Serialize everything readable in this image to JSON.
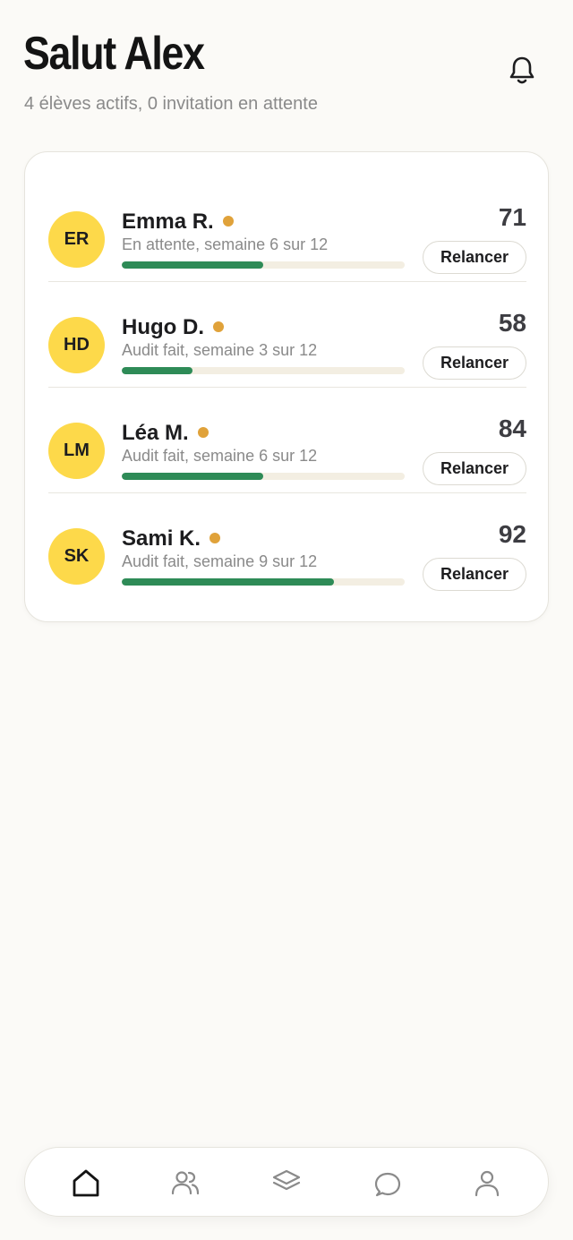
{
  "header": {
    "title": "Salut Alex",
    "subtitle": "4 élèves actifs, 0 invitation en attente",
    "notification_icon": "bell-icon"
  },
  "students": [
    {
      "initials": "ER",
      "name": "Emma R.",
      "status": "En attente, semaine 6 sur 12",
      "progress": 0.5,
      "score": "71",
      "action": "Relancer"
    },
    {
      "initials": "HD",
      "name": "Hugo D.",
      "status": "Audit fait, semaine 3 sur 12",
      "progress": 0.25,
      "score": "58",
      "action": "Relancer"
    },
    {
      "initials": "LM",
      "name": "Léa M.",
      "status": "Audit fait, semaine 6 sur 12",
      "progress": 0.5,
      "score": "84",
      "action": "Relancer"
    },
    {
      "initials": "SK",
      "name": "Sami K.",
      "status": "Audit fait, semaine 9 sur 12",
      "progress": 0.75,
      "score": "92",
      "action": "Relancer"
    }
  ],
  "nav": {
    "items": [
      {
        "icon": "home-icon",
        "active": true
      },
      {
        "icon": "users-icon",
        "active": false
      },
      {
        "icon": "layers-icon",
        "active": false
      },
      {
        "icon": "chat-bubble-icon",
        "active": false
      },
      {
        "icon": "profile-icon",
        "active": false
      }
    ]
  },
  "colors": {
    "background": "#fbfaf7",
    "avatar": "#fdd94a",
    "status_dot": "#e0a23a",
    "progress_fill": "#2e8b57",
    "progress_track": "#f3eee2"
  }
}
